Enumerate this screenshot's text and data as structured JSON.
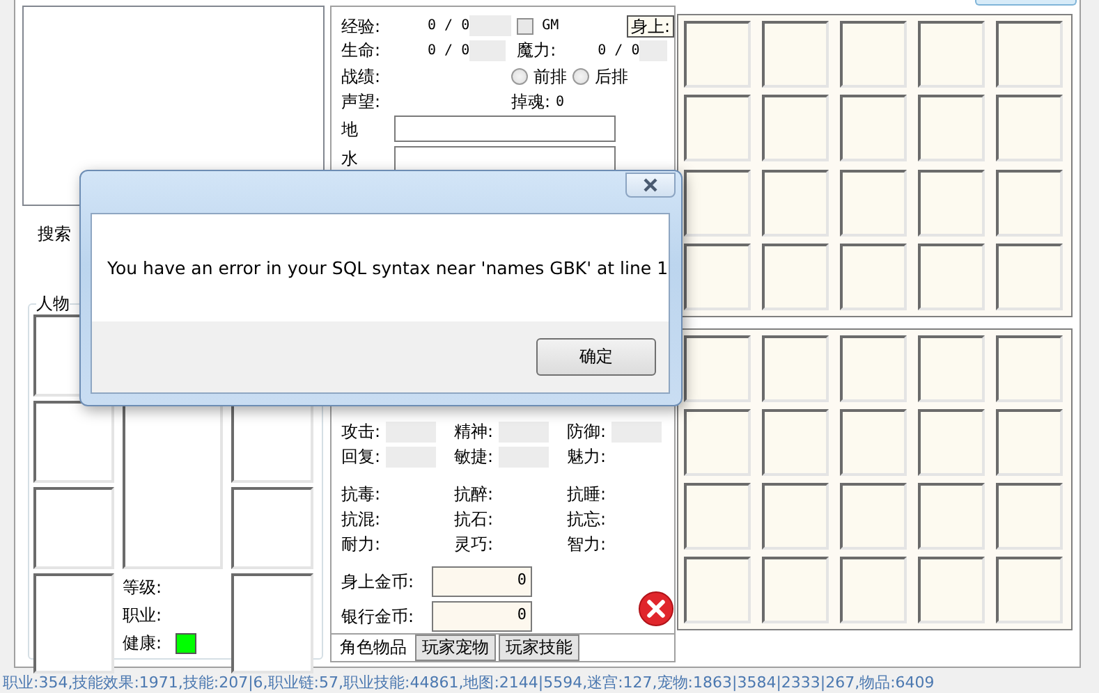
{
  "search_label": "搜索",
  "character_group": {
    "title": "人物",
    "labels": [
      {
        "label": "等级:"
      },
      {
        "label": "职业:"
      },
      {
        "label": "健康:",
        "color": "#00ff00"
      }
    ]
  },
  "stats": {
    "exp": {
      "label": "经验:",
      "value": "0 / 0"
    },
    "gm": {
      "label": "GM",
      "checked": false
    },
    "on_body_tab": "身上:",
    "hp": {
      "label": "生命:",
      "value": "0 / 0"
    },
    "mp": {
      "label": "魔力:",
      "value": "0 / 0"
    },
    "record": "战绩:",
    "positions": [
      {
        "label": "前排",
        "selected": false
      },
      {
        "label": "后排",
        "selected": false
      }
    ],
    "fame": "声望:",
    "soul": {
      "label": "掉魂:",
      "value": "0"
    }
  },
  "elements": [
    {
      "label": "地"
    },
    {
      "label": "水"
    }
  ],
  "attributes": [
    {
      "label": "攻击:",
      "kind": "boxed"
    },
    {
      "label": "精神:",
      "kind": "boxed"
    },
    {
      "label": "防御:",
      "kind": "boxed"
    },
    {
      "label": "回复:",
      "kind": "boxed"
    },
    {
      "label": "敏捷:",
      "kind": "boxed"
    },
    {
      "label": "魅力:",
      "kind": "plain"
    }
  ],
  "resistances": [
    "抗毒:",
    "抗醉:",
    "抗睡:",
    "抗混:",
    "抗石:",
    "抗忘:",
    "耐力:",
    "灵巧:",
    "智力:"
  ],
  "gold": [
    {
      "label": "身上金币:",
      "value": "0"
    },
    {
      "label": "银行金币:",
      "value": "0"
    }
  ],
  "tabs": [
    {
      "label": "角色物品",
      "selected": true
    },
    {
      "label": "玩家宠物",
      "selected": false
    },
    {
      "label": "玩家技能",
      "selected": false
    }
  ],
  "dialog": {
    "message": "You have an error in your SQL syntax near 'names GBK' at line 1",
    "buttons": [
      "确定"
    ]
  },
  "status_bar": "职业:354,技能效果:1971,技能:207|6,职业链:57,职业技能:44861,地图:2144|5594,迷宫:127,宠物:1863|3584|2333|267,物品:6409"
}
